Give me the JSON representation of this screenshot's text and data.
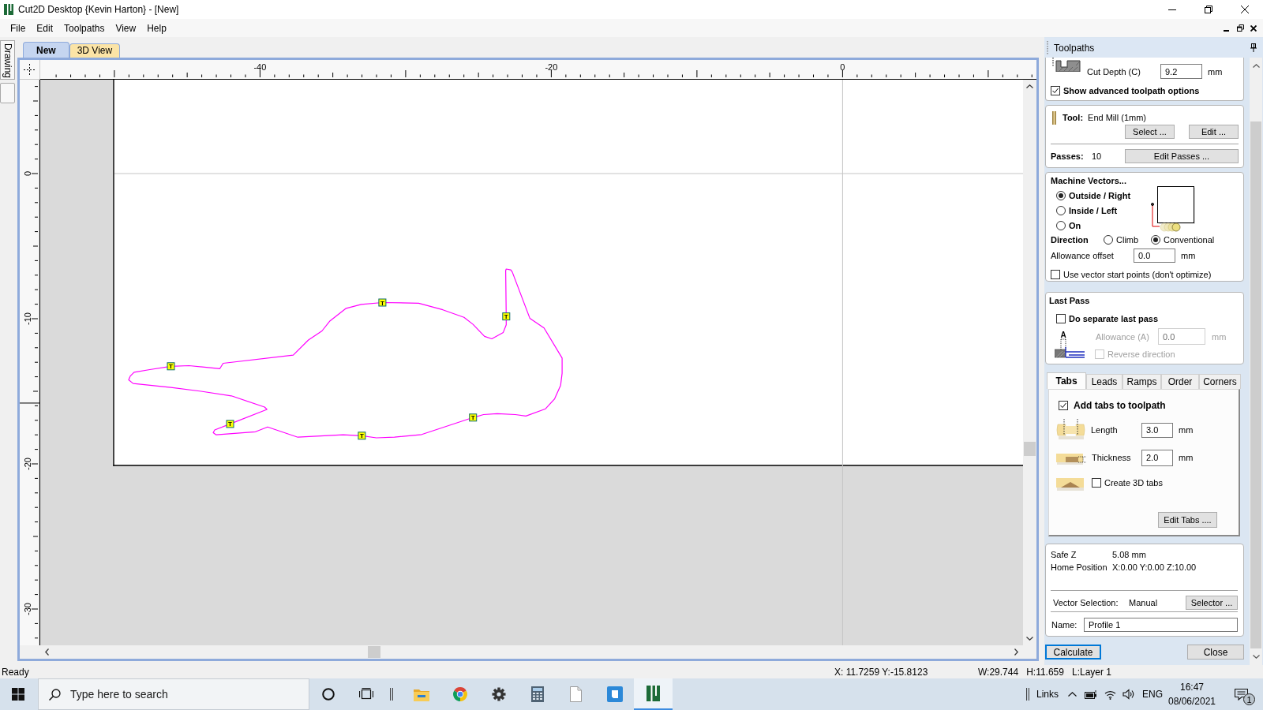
{
  "window": {
    "title": "Cut2D Desktop {Kevin Harton} - [New]"
  },
  "menu": [
    "File",
    "Edit",
    "Toolpaths",
    "View",
    "Help"
  ],
  "side_tabs": [
    "Drawing"
  ],
  "document_tabs": [
    {
      "label": "New",
      "selected": true,
      "color": "#c5d5f0"
    },
    {
      "label": "3D View",
      "selected": false,
      "color": "#fbe4a6"
    }
  ],
  "rulers": {
    "x_labels": [
      "-40",
      "-20",
      "0"
    ],
    "y_labels": [
      "0",
      "-10",
      "-20",
      "-30"
    ]
  },
  "canvas": {
    "tab_markers": [
      "T",
      "T",
      "T",
      "T",
      "T",
      "T"
    ]
  },
  "toolpaths_panel": {
    "title": "Toolpaths",
    "cut_depth": {
      "label": "Cut Depth (C)",
      "value": "9.2",
      "unit": "mm"
    },
    "show_advanced": {
      "label": "Show advanced toolpath options",
      "checked": true
    },
    "tool": {
      "label": "Tool:",
      "name": "End Mill (1mm)",
      "select_button": "Select ...",
      "edit_button": "Edit ..."
    },
    "passes": {
      "label": "Passes:",
      "value": "10",
      "button": "Edit Passes ..."
    },
    "machine_vectors": {
      "title": "Machine Vectors...",
      "options": [
        {
          "label": "Outside / Right",
          "selected": true
        },
        {
          "label": "Inside / Left",
          "selected": false
        },
        {
          "label": "On",
          "selected": false
        }
      ],
      "direction_label": "Direction",
      "directions": [
        {
          "label": "Climb",
          "selected": false
        },
        {
          "label": "Conventional",
          "selected": true
        }
      ],
      "allowance": {
        "label": "Allowance offset",
        "value": "0.0",
        "unit": "mm"
      },
      "use_start_points": {
        "label": "Use vector start points (don't optimize)",
        "checked": false
      }
    },
    "last_pass": {
      "title": "Last Pass",
      "separate": {
        "label": "Do separate last pass",
        "checked": false
      },
      "diagram_label": "A",
      "allowance": {
        "label": "Allowance (A)",
        "value": "0.0",
        "unit": "mm",
        "disabled": true
      },
      "reverse": {
        "label": "Reverse direction",
        "checked": false,
        "disabled": true
      }
    },
    "option_tabs": [
      {
        "label": "Tabs",
        "selected": true
      },
      {
        "label": "Leads",
        "selected": false
      },
      {
        "label": "Ramps",
        "selected": false
      },
      {
        "label": "Order",
        "selected": false
      },
      {
        "label": "Corners",
        "selected": false
      }
    ],
    "tabs_page": {
      "add_tabs": {
        "label": "Add tabs to toolpath",
        "checked": true
      },
      "length": {
        "label": "Length",
        "value": "3.0",
        "unit": "mm"
      },
      "thickness": {
        "label": "Thickness",
        "value": "2.0",
        "unit": "mm"
      },
      "create_3d": {
        "label": "Create 3D tabs",
        "checked": false
      },
      "edit_button": "Edit Tabs ...."
    },
    "summary": {
      "rows": [
        {
          "label": "Safe Z",
          "value": "5.08 mm"
        },
        {
          "label": "Home Position",
          "value": "X:0.00 Y:0.00 Z:10.00"
        }
      ],
      "vector_selection": {
        "label": "Vector Selection:",
        "value": "Manual",
        "button": "Selector ..."
      },
      "name": {
        "label": "Name:",
        "value": "Profile 1"
      }
    },
    "buttons": [
      {
        "label": "Calculate",
        "focused": true
      },
      {
        "label": "Close",
        "focused": false
      }
    ]
  },
  "status_bar": {
    "message": "Ready",
    "cursor": "X: 11.7259 Y:-15.8123",
    "fields": [
      "W:29.744",
      "H:11.659",
      "L:Layer 1"
    ]
  },
  "taskbar": {
    "search_placeholder": "Type here to search",
    "apps": [
      {
        "selected": false
      },
      {
        "selected": false
      },
      {
        "selected": false
      },
      {
        "selected": false
      },
      {
        "selected": false
      },
      {
        "selected": false
      },
      {
        "selected": true
      }
    ],
    "toolbar_label": "Links",
    "language": "ENG",
    "time": "16:47",
    "date": "08/06/2021",
    "notification_count": "1"
  }
}
